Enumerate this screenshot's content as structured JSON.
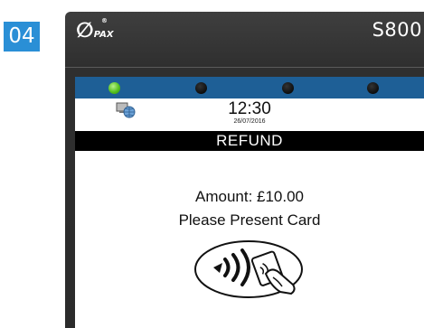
{
  "step": {
    "number": "04",
    "color": "#2a8fd6"
  },
  "device": {
    "brand": "PAX",
    "brand_mark": "registered",
    "model": "S800"
  },
  "leds": [
    {
      "state": "on",
      "color": "#56c11f"
    },
    {
      "state": "off",
      "color": "#0d0d0d"
    },
    {
      "state": "off",
      "color": "#0d0d0d"
    },
    {
      "state": "off",
      "color": "#0d0d0d"
    }
  ],
  "status": {
    "network_icon": "network-globe-icon",
    "time": "12:30",
    "date": "26/07/2016"
  },
  "screen": {
    "title": "REFUND",
    "amount_text": "Amount: £10.00",
    "prompt_text": "Please Present Card",
    "contactless_icon": "contactless-card-tap-icon"
  }
}
